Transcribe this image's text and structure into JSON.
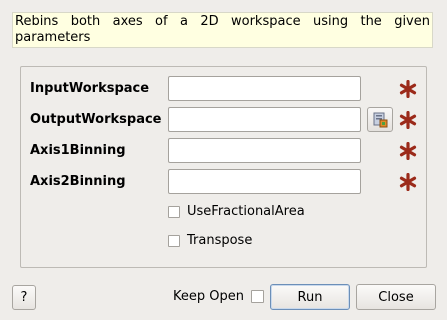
{
  "description": "Rebins both axes of a 2D workspace using the given parameters",
  "fields": [
    {
      "label": "InputWorkspace",
      "value": "",
      "required": true
    },
    {
      "label": "OutputWorkspace",
      "value": "",
      "required": true,
      "has_browse": true
    },
    {
      "label": "Axis1Binning",
      "value": "",
      "required": true
    },
    {
      "label": "Axis2Binning",
      "value": "",
      "required": true
    }
  ],
  "checkboxes": [
    {
      "label": "UseFractionalArea",
      "checked": false
    },
    {
      "label": "Transpose",
      "checked": false
    }
  ],
  "footer": {
    "help_label": "?",
    "keep_open_label": "Keep Open",
    "keep_open_checked": false,
    "run_label": "Run",
    "close_label": "Close"
  },
  "colors": {
    "required_star": "#9b2a1a",
    "description_bg": "#ffffe1",
    "window_bg": "#efedea"
  },
  "icons": {
    "required": "required-star-icon",
    "browse": "workspace-browse-icon"
  }
}
